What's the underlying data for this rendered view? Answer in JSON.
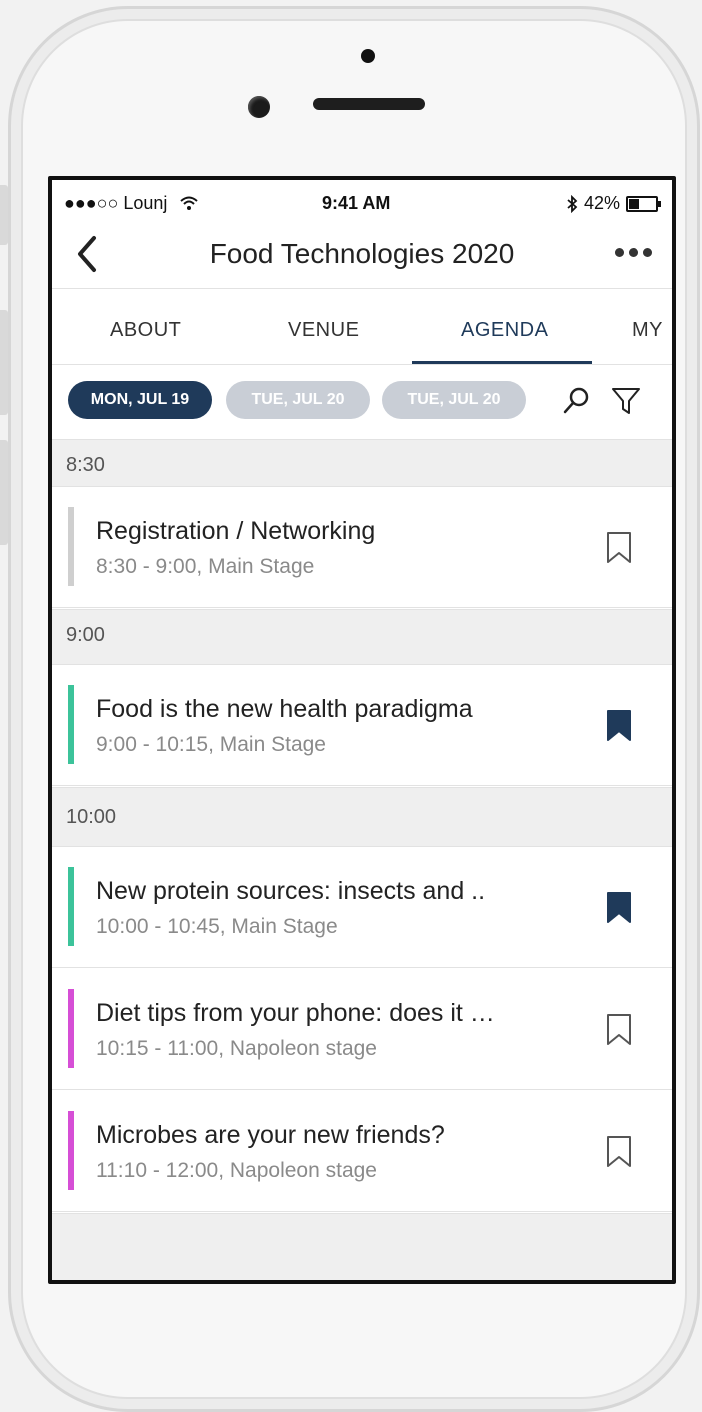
{
  "status_bar": {
    "carrier": "●●●○○ Lounj",
    "time": "9:41 AM",
    "battery": "42%",
    "battery_level": 0.42
  },
  "header": {
    "title": "Food Technologies 2020"
  },
  "tabs": [
    {
      "label": "ABOUT",
      "active": false
    },
    {
      "label": "VENUE",
      "active": false
    },
    {
      "label": "AGENDA",
      "active": true
    },
    {
      "label": "MY",
      "active": false
    }
  ],
  "dates": [
    {
      "label": "MON, JUL 19",
      "active": true
    },
    {
      "label": "TUE, JUL 20",
      "active": false
    },
    {
      "label": "TUE, JUL 20",
      "active": false
    }
  ],
  "colors": {
    "primary": "#1f3a5a",
    "stage_main": "#3cc39a",
    "stage_napoleon": "#d64fd6",
    "neutral_bar": "#cfcfcf"
  },
  "agenda": {
    "slot_830": "8:30",
    "slot_900": "9:00",
    "slot_1000": "10:00",
    "sessions": [
      {
        "title": "Registration / Networking",
        "subtitle": "8:30 - 9:00, Main Stage",
        "bookmarked": false
      },
      {
        "title": "Food is the new health paradigma",
        "subtitle": "9:00 - 10:15, Main Stage",
        "bookmarked": true
      },
      {
        "title": "New protein sources: insects and ..",
        "subtitle": "10:00 - 10:45, Main Stage",
        "bookmarked": true
      },
      {
        "title": "Diet tips from your phone: does it …",
        "subtitle": "10:15 - 11:00, Napoleon stage",
        "bookmarked": false
      },
      {
        "title": "Microbes are your new friends?",
        "subtitle": "11:10 - 12:00, Napoleon stage",
        "bookmarked": false
      }
    ]
  }
}
